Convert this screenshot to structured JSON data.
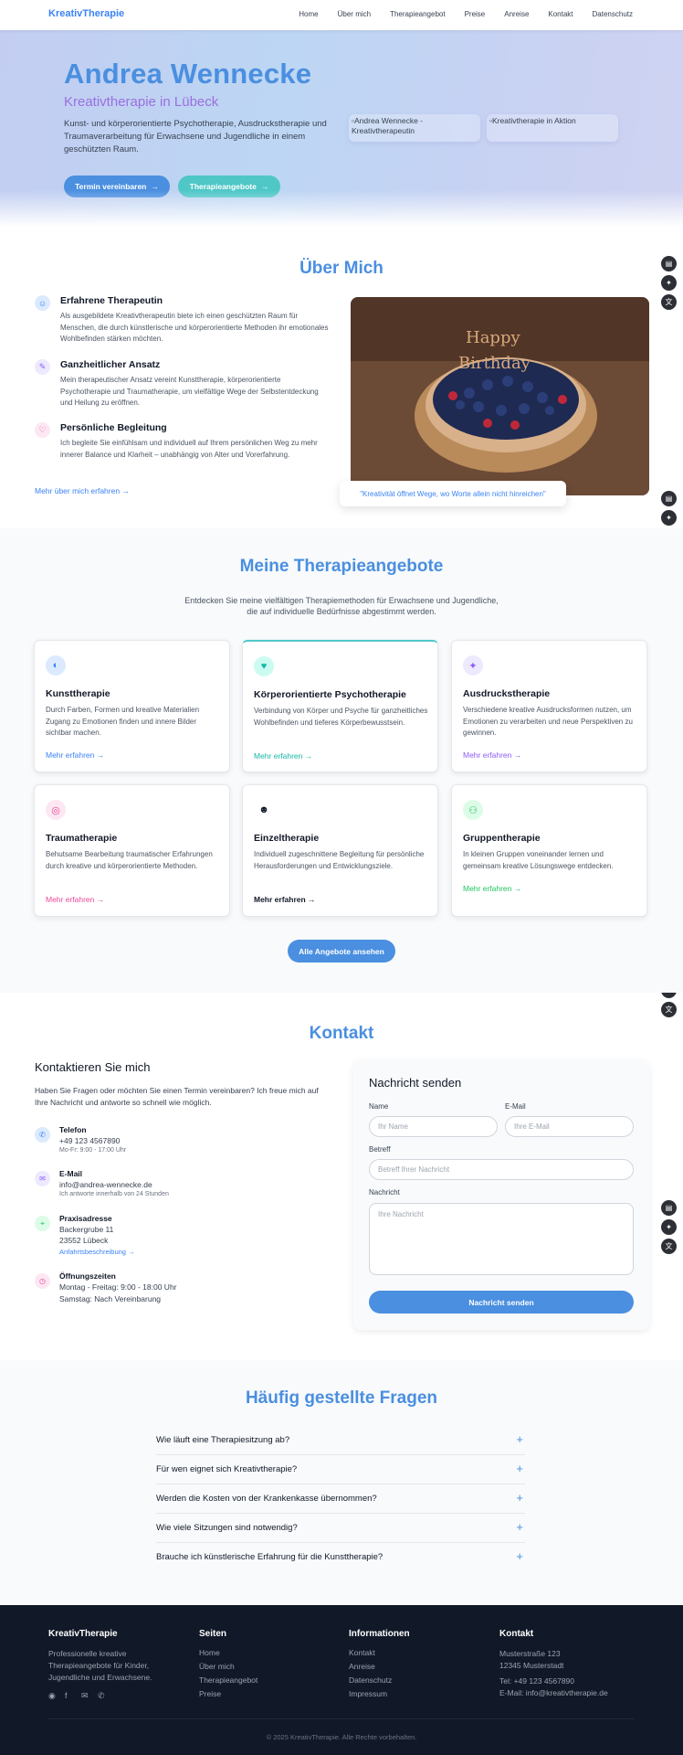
{
  "nav": {
    "brand": "KreativTherapie",
    "links": [
      "Home",
      "Über mich",
      "Therapieangebot",
      "Preise",
      "Anreise",
      "Kontakt",
      "Datenschutz"
    ]
  },
  "hero": {
    "title": "Andrea Wennecke",
    "subtitle": "Kreativtherapie in Lübeck",
    "description": "Kunst- und körperorientierte Psychotherapie, Ausdruckstherapie und Traumaverarbeitung für Erwachsene und Jugendliche in einem geschützten Raum.",
    "btn_primary": "Termin vereinbaren",
    "btn_secondary": "Therapieangebote",
    "img1_alt": "Andrea Wennecke - Kreativtherapeutin",
    "img2_alt": "Kreativtherapie in Aktion"
  },
  "about": {
    "title": "Über Mich",
    "items": [
      {
        "heading": "Erfahrene Therapeutin",
        "text": "Als ausgebildete Kreativtherapeutin biete ich einen geschützten Raum für Menschen, die durch künstlerische und körperorientierte Methoden ihr emotionales Wohlbefinden stärken möchten."
      },
      {
        "heading": "Ganzheitlicher Ansatz",
        "text": "Mein therapeutischer Ansatz vereint Kunsttherapie, körperorientierte Psychotherapie und Traumatherapie, um vielfältige Wege der Selbstentdeckung und Heilung zu eröffnen."
      },
      {
        "heading": "Persönliche Begleitung",
        "text": "Ich begleite Sie einfühlsam und individuell auf Ihrem persönlichen Weg zu mehr innerer Balance und Klarheit – unabhängig von Alter und Vorerfahrung."
      }
    ],
    "link": "Mehr über mich erfahren →",
    "quote": "\"Kreativität öffnet Wege, wo Worte allein nicht hinreichen\""
  },
  "offers": {
    "title": "Meine Therapieangebote",
    "subtitle_line1": "Entdecken Sie meine vielfältigen Therapiemethoden für Erwachsene und Jugendliche,",
    "subtitle_line2": "die auf individuelle Bedürfnisse abgestimmt werden.",
    "cards": [
      {
        "title": "Kunsttherapie",
        "text": "Durch Farben, Formen und kreative Materialien Zugang zu Emotionen finden und innere Bilder sichtbar machen.",
        "link": "Mehr erfahren →",
        "color": "#3b82f6",
        "icon": "palette-icon"
      },
      {
        "title": "Körperorientierte Psychotherapie",
        "text": "Verbindung von Körper und Psyche für ganzheitliches Wohlbefinden und tieferes Körperbewusstsein.",
        "link": "Mehr erfahren →",
        "color": "#14b8a6",
        "icon": "heart-hand-icon"
      },
      {
        "title": "Ausdruckstherapie",
        "text": "Verschiedene kreative Ausdrucksformen nutzen, um Emotionen zu verarbeiten und neue Perspektiven zu gewinnen.",
        "link": "Mehr erfahren →",
        "color": "#8b5cf6",
        "icon": "sparkle-icon"
      },
      {
        "title": "Traumatherapie",
        "text": "Behutsame Bearbeitung traumatischer Erfahrungen durch kreative und körperorientierte Methoden.",
        "link": "Mehr erfahren →",
        "color": "#ec4899",
        "icon": "shield-icon"
      },
      {
        "title": "Einzeltherapie",
        "text": "Individuell zugeschnittene Begleitung für persönliche Herausforderungen und Entwicklungsziele.",
        "link": "Mehr erfahren →",
        "color": "#111827",
        "icon": "person-icon"
      },
      {
        "title": "Gruppentherapie",
        "text": "In kleinen Gruppen voneinander lernen und gemeinsam kreative Lösungswege entdecken.",
        "link": "Mehr erfahren →",
        "color": "#22c55e",
        "icon": "group-icon"
      }
    ],
    "btn_all": "Alle Angebote ansehen"
  },
  "contact": {
    "title": "Kontakt",
    "heading": "Kontaktieren Sie mich",
    "intro": "Haben Sie Fragen oder möchten Sie einen Termin vereinbaren? Ich freue mich auf Ihre Nachricht und antworte so schnell wie möglich.",
    "phone_label": "Telefon",
    "phone": "+49 123 4567890",
    "phone_hours": "Mo-Fr: 9:00 - 17:00 Uhr",
    "email_label": "E-Mail",
    "email": "info@andrea-wennecke.de",
    "email_note": "Ich antworte innerhalb von 24 Stunden",
    "address_label": "Praxisadresse",
    "address_street": "Backergrube 11",
    "address_city": "23552 Lübeck",
    "address_link": "Anfahrtsbeschreibung →",
    "hours_label": "Öffnungszeiten",
    "hours_week": "Montag - Freitag: 9:00 - 18:00 Uhr",
    "hours_sat": "Samstag: Nach Vereinbarung",
    "form": {
      "title": "Nachricht senden",
      "name_label": "Name",
      "name_ph": "Ihr Name",
      "email_label": "E-Mail",
      "email_ph": "Ihre E-Mail",
      "subject_label": "Betreff",
      "subject_ph": "Betreff Ihrer Nachricht",
      "message_label": "Nachricht",
      "message_ph": "Ihre Nachricht",
      "submit": "Nachricht senden"
    }
  },
  "faq": {
    "title": "Häufig gestellte Fragen",
    "questions": [
      "Wie läuft eine Therapiesitzung ab?",
      "Für wen eignet sich Kreativtherapie?",
      "Werden die Kosten von der Krankenkasse übernommen?",
      "Wie viele Sitzungen sind notwendig?",
      "Brauche ich künstlerische Erfahrung für die Kunsttherapie?"
    ]
  },
  "footer": {
    "brand": "KreativTherapie",
    "tagline": "Professionelle kreative Therapieangebote für Kinder, Jugendliche und Erwachsene.",
    "col_pages": "Seiten",
    "pages": [
      "Home",
      "Über mich",
      "Therapieangebot",
      "Preise"
    ],
    "col_info": "Informationen",
    "info": [
      "Kontakt",
      "Anreise",
      "Datenschutz",
      "Impressum"
    ],
    "col_contact": "Kontakt",
    "street": "Musterstraße 123",
    "city": "12345 Musterstadt",
    "tel": "Tel: +49 123 4567890",
    "mail": "E-Mail: info@kreativtherapie.de",
    "copyright": "© 2025 KreativTherapie. Alle Rechte vorbehalten."
  }
}
